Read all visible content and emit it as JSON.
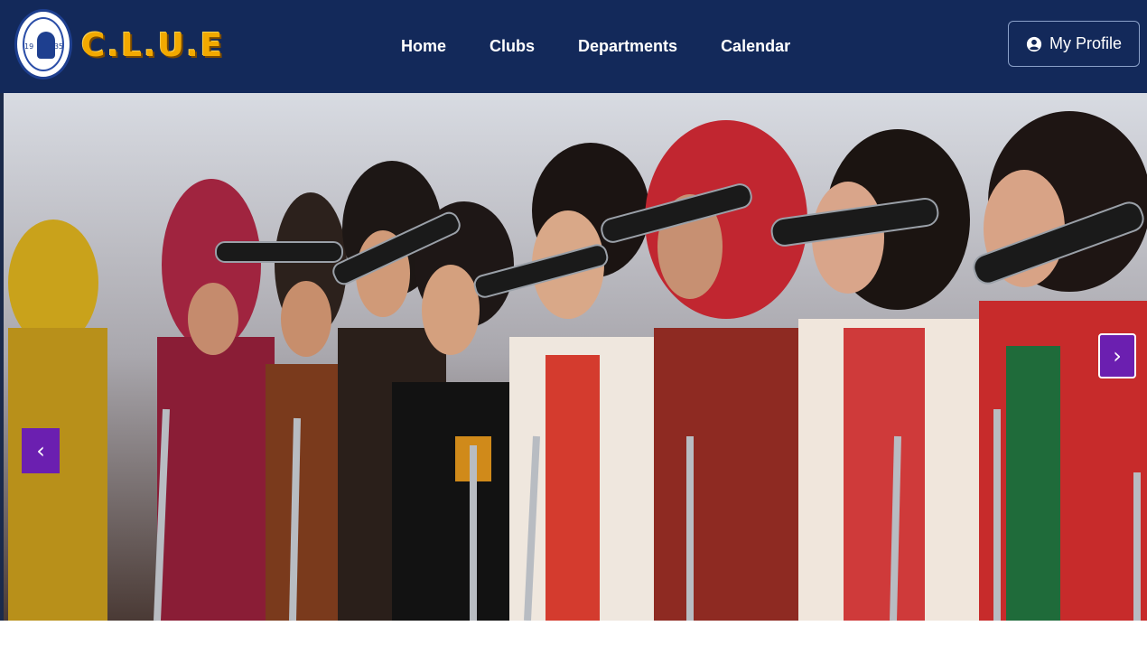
{
  "brand": {
    "name": "C.L.U.E",
    "seal_year_left": "19",
    "seal_year_right": "35",
    "seal_icon": "university-seal-icon"
  },
  "nav": {
    "items": [
      {
        "label": "Home"
      },
      {
        "label": "Clubs"
      },
      {
        "label": "Departments"
      },
      {
        "label": "Calendar"
      }
    ]
  },
  "profile": {
    "label": "My Profile",
    "icon": "user-circle-icon"
  },
  "carousel": {
    "prev_symbol": "‹",
    "next_symbol": "›",
    "prev_icon": "chevron-left-icon",
    "next_icon": "chevron-right-icon",
    "image_subject": "women-singing-at-microphones-photo"
  },
  "colors": {
    "navbar_bg": "#13295a",
    "brand_text": "#f2a900",
    "carousel_button": "#6b1fb0"
  }
}
